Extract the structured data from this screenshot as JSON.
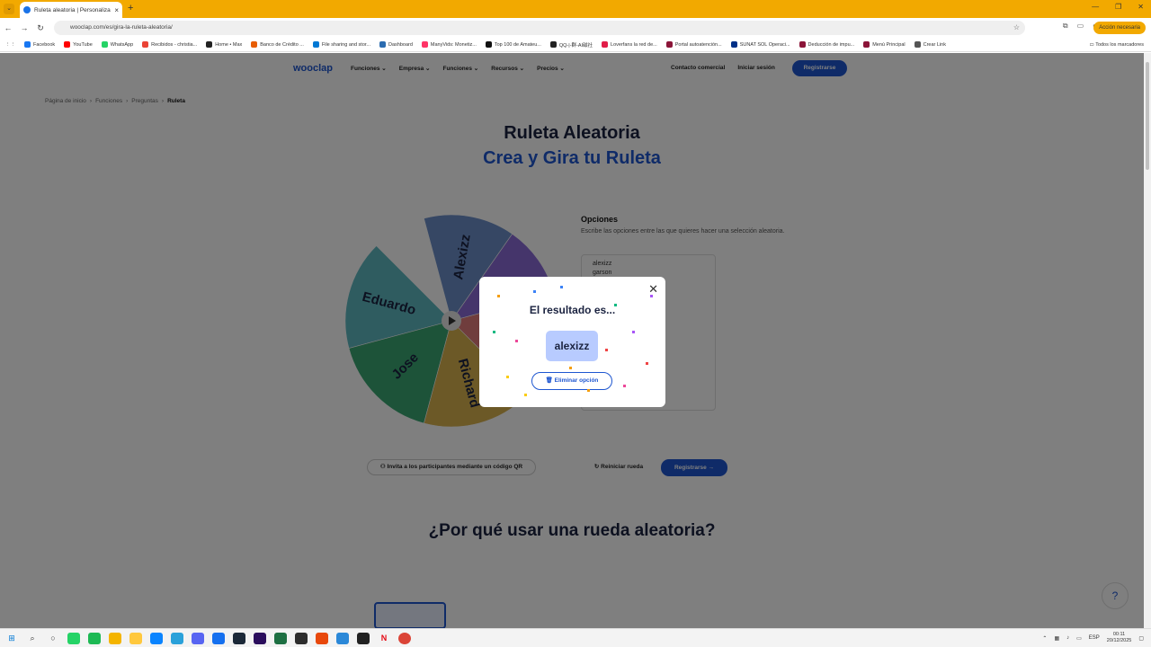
{
  "browser": {
    "tab_title": "Ruleta aleatoria | Personaliza y ...",
    "url": "wooclap.com/es/gira-la-ruleta-aleatoria/",
    "action_button": "Acción necesaria",
    "bookmarks": [
      {
        "label": "Facebook",
        "color": "#1877f2"
      },
      {
        "label": "YouTube",
        "color": "#ff0000"
      },
      {
        "label": "WhatsApp",
        "color": "#25d366"
      },
      {
        "label": "Recibidos - christia...",
        "color": "#ea4335"
      },
      {
        "label": "Home • Max",
        "color": "#222222"
      },
      {
        "label": "Banco de Crédito ...",
        "color": "#e85d04"
      },
      {
        "label": "File sharing and stor...",
        "color": "#0078d4"
      },
      {
        "label": "Dashboard",
        "color": "#2b6cb0"
      },
      {
        "label": "ManyVids: Monetiz...",
        "color": "#ff3366"
      },
      {
        "label": "Top 100 de Amateu...",
        "color": "#111111"
      },
      {
        "label": "QQ-|-群-AI磁社",
        "color": "#222222"
      },
      {
        "label": "Loverfans la red de...",
        "color": "#e11d48"
      },
      {
        "label": "Portal autoatención...",
        "color": "#8b1538"
      },
      {
        "label": "SUNAT SOL Operaci...",
        "color": "#003087"
      },
      {
        "label": "Deducción de impu...",
        "color": "#8b1538"
      },
      {
        "label": "Menú Principal",
        "color": "#8b1538"
      },
      {
        "label": "Crear Link",
        "color": "#555555"
      }
    ],
    "bookmarks_folder": "Todos los marcadores"
  },
  "nav": {
    "logo": "wooclap",
    "menu": [
      "Funciones ⌄",
      "Empresa ⌄",
      "Funciones ⌄",
      "Recursos ⌄",
      "Precios ⌄"
    ],
    "contacto": "Contacto comercial",
    "login": "Iniciar sesión",
    "register": "Registrarse"
  },
  "breadcrumb": [
    "Página de inicio",
    "Funciones",
    "Preguntas",
    "Ruleta"
  ],
  "hero": {
    "title": "Ruleta Aleatoria",
    "subtitle": "Crea y Gira tu Ruleta"
  },
  "wheel": {
    "segments": [
      {
        "label": "Alexizz",
        "color": "#6c8ec9"
      },
      {
        "label": "Eduardo",
        "color": "#5fb8c0"
      },
      {
        "label": "Jose",
        "color": "#3aa673"
      },
      {
        "label": "Richard",
        "color": "#d8b24e"
      },
      {
        "label": "",
        "color": "#e07a7a"
      },
      {
        "label": "",
        "color": "#8a6ad6"
      }
    ]
  },
  "options": {
    "title": "Opciones",
    "subtitle": "Escribe las opciones entre las que quieres hacer una selección aleatoria.",
    "items": [
      "alexizz",
      "garson"
    ]
  },
  "actions": {
    "qr": "Invita a los participantes mediante un código QR",
    "reset": "Reiniciar rueda",
    "register": "Registrarse →"
  },
  "section": {
    "why_title": "¿Por qué usar una rueda aleatoria?"
  },
  "modal": {
    "title": "El resultado es...",
    "result": "alexizz",
    "delete": "Eliminar opción"
  },
  "tray": {
    "lang": "ESP",
    "time": "00:11",
    "date": "20/12/2025"
  }
}
